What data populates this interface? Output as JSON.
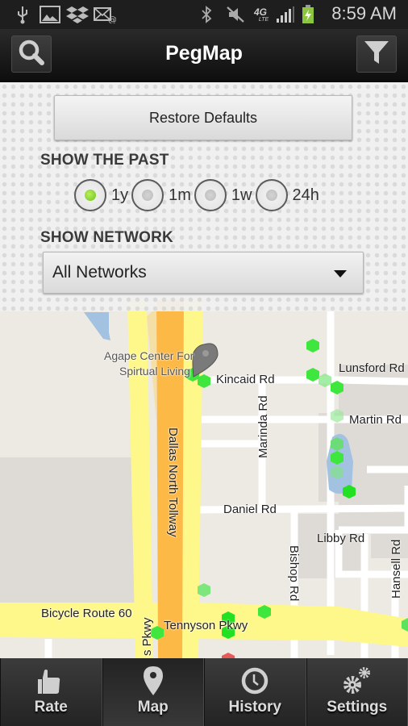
{
  "status_bar": {
    "left_icons": [
      "usb-icon",
      "gallery-icon",
      "dropbox-icon",
      "email-icon"
    ],
    "right_icons": [
      "bluetooth-icon",
      "mute-icon",
      "4g-lte-icon",
      "signal-icon",
      "battery-charging-icon"
    ],
    "network_label": "4G",
    "network_sub": "LTE",
    "time": "8:59 AM"
  },
  "action_bar": {
    "title": "PegMap",
    "search_icon": "search-icon",
    "filter_icon": "filter-icon"
  },
  "filter_panel": {
    "restore_label": "Restore Defaults",
    "show_past_label": "SHOW THE PAST",
    "time_options": [
      {
        "label": "1y",
        "selected": true
      },
      {
        "label": "1m",
        "selected": false
      },
      {
        "label": "1w",
        "selected": false
      },
      {
        "label": "24h",
        "selected": false
      }
    ],
    "show_network_label": "SHOW NETWORK",
    "network_selected": "All Networks"
  },
  "map": {
    "place_label_line1": "Agape Center For",
    "place_label_line2": "Spirtual Living",
    "streets": {
      "kincaid": "Kincaid Rd",
      "lunsford": "Lunsford Rd",
      "martin": "Martin Rd",
      "marinda": "Marinda Rd",
      "tollway": "Dallas North Tollway",
      "daniel": "Daniel Rd",
      "libby": "Libby Rd",
      "bishop": "Bishop Rd",
      "hansell": "Hansell Rd",
      "bicycle": "Bicycle Route 60",
      "tennyson": "Tennyson Pkwy",
      "tennyson_v": "s Pkwy"
    },
    "colors": {
      "strong_signal": "#3ee63e",
      "weak_signal": "#9be89b",
      "bad_signal": "#e85a5a",
      "highway": "#fdb945",
      "arterial": "#fef88a",
      "water": "#a3c2e2"
    }
  },
  "tabs": [
    {
      "label": "Rate",
      "icon": "thumbs-up-icon",
      "active": false
    },
    {
      "label": "Map",
      "icon": "map-pin-icon",
      "active": true
    },
    {
      "label": "History",
      "icon": "clock-icon",
      "active": false
    },
    {
      "label": "Settings",
      "icon": "gears-icon",
      "active": false
    }
  ]
}
